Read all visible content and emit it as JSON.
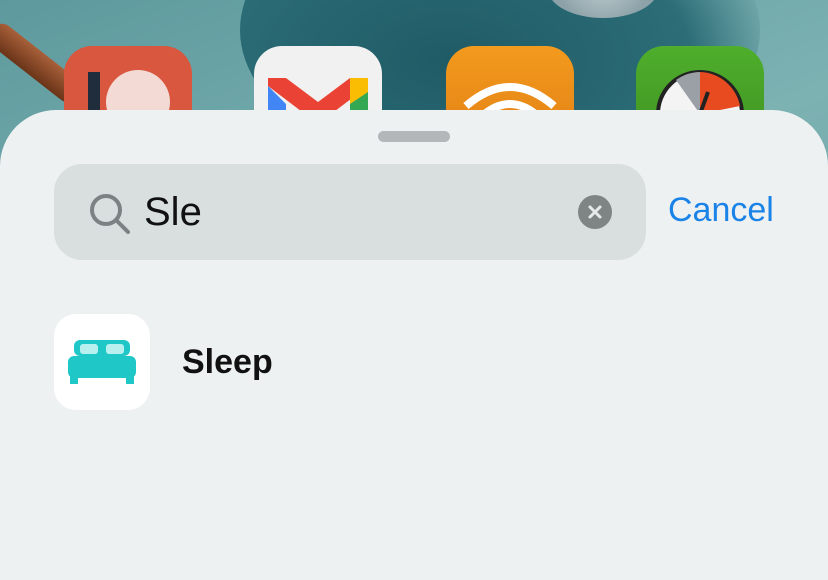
{
  "background_apps": [
    {
      "name": "patreon-app-icon"
    },
    {
      "name": "gmail-app-icon"
    },
    {
      "name": "audible-app-icon"
    },
    {
      "name": "speedtest-app-icon"
    }
  ],
  "search": {
    "value": "Sle",
    "clear_icon": "xmark-circle-icon",
    "search_icon": "magnifying-glass-icon"
  },
  "cancel_label": "Cancel",
  "results": [
    {
      "label": "Sleep",
      "icon": "bed-icon",
      "icon_color": "#20c7c7"
    }
  ],
  "colors": {
    "accent": "#1a83e8",
    "sheet": "#edf1f1"
  }
}
